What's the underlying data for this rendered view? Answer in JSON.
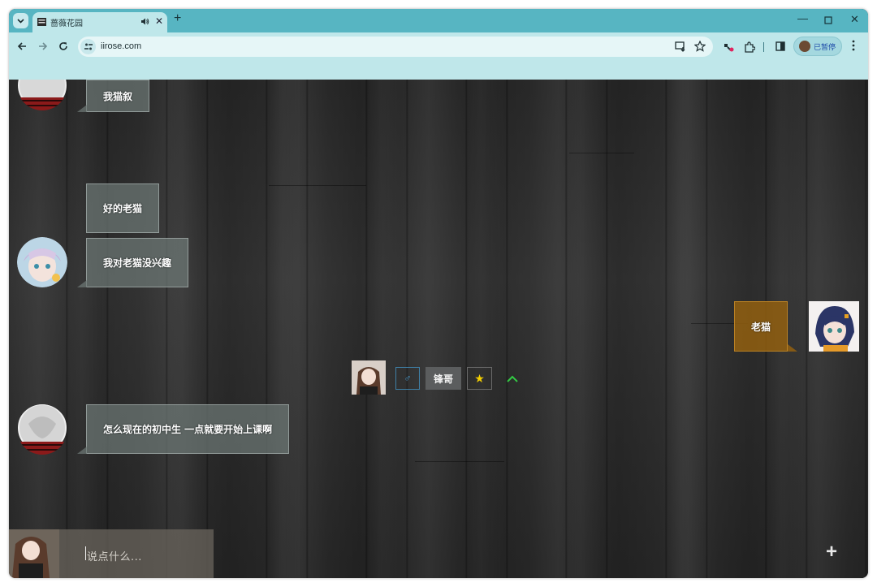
{
  "browser": {
    "tab_title": "蔷薇花园",
    "url": "iirose.com",
    "profile_label": "已暂停"
  },
  "messages": [
    {
      "text": "我猫叙",
      "side": "left",
      "avatar": "snow-globe-avatar"
    },
    {
      "text": "好的老猫",
      "side": "left",
      "avatar": "anime-boy-avatar"
    },
    {
      "text": "我对老猫没兴趣",
      "side": "left",
      "avatar": "anime-boy-avatar"
    },
    {
      "text": "老猫",
      "side": "right",
      "avatar": "anime-girl-avatar"
    },
    {
      "text": "怎么现在的初中生 一点就要开始上课啊",
      "side": "left",
      "avatar": "snow-globe-avatar"
    }
  ],
  "userbar": {
    "gender_symbol": "♂",
    "name": "锋哥",
    "star_symbol": "★",
    "up_symbol": "^"
  },
  "composer": {
    "placeholder": "说点什么...",
    "plus_symbol": "+"
  },
  "colors": {
    "tab_strip": "#57b5c2",
    "toolbar": "#bfe7ea",
    "left_bubble": "#6e7876",
    "right_bubble": "#96620f"
  }
}
